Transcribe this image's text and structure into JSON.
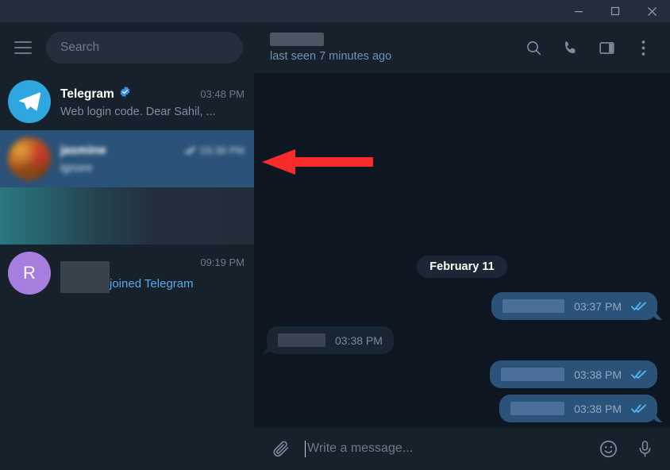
{
  "window": {
    "minimize_label": "Minimize",
    "maximize_label": "Maximize",
    "close_label": "Close"
  },
  "sidebar": {
    "menu_icon": "hamburger-icon",
    "search": {
      "placeholder": "Search",
      "value": ""
    },
    "chats": [
      {
        "name": "Telegram",
        "verified": true,
        "time": "03:48 PM",
        "preview": "Web login code. Dear Sahil, ...",
        "avatar_type": "telegram-logo",
        "avatar_label": "",
        "selected": false,
        "redacted": false
      },
      {
        "name": "jasmine",
        "verified": false,
        "time": "03:38 PM",
        "preview": "ignore",
        "avatar_type": "photo",
        "avatar_label": "",
        "selected": true,
        "redacted": true,
        "outgoing_tick": true
      },
      {
        "name": "",
        "verified": false,
        "time": "",
        "preview": "",
        "avatar_type": "none",
        "avatar_label": "",
        "selected": false,
        "redacted": true,
        "fully_obscured": true
      },
      {
        "name": "",
        "verified": false,
        "time": "09:19 PM",
        "preview": "joined Telegram",
        "avatar_type": "letter",
        "avatar_label": "R",
        "selected": false,
        "redacted": false,
        "name_redacted": true
      }
    ]
  },
  "chat_header": {
    "title": "",
    "title_redacted": true,
    "status": "last seen 7 minutes ago",
    "actions": [
      {
        "icon": "search-icon",
        "label": "Search in chat"
      },
      {
        "icon": "phone-icon",
        "label": "Call"
      },
      {
        "icon": "panel-toggle-icon",
        "label": "Toggle info panel"
      },
      {
        "icon": "more-vertical-icon",
        "label": "More options"
      }
    ]
  },
  "conversation": {
    "date_separator": "February 11",
    "messages": [
      {
        "direction": "out",
        "text": "",
        "redacted": true,
        "time": "03:37 PM",
        "status": "read",
        "tail": true,
        "redact_width": 78
      },
      {
        "direction": "in",
        "text": "",
        "redacted": true,
        "time": "03:38 PM",
        "status": "",
        "tail": true,
        "redact_width": 60
      },
      {
        "direction": "out",
        "text": "",
        "redacted": true,
        "time": "03:38 PM",
        "status": "read",
        "tail": false,
        "redact_width": 80
      },
      {
        "direction": "out",
        "text": "",
        "redacted": true,
        "time": "03:38 PM",
        "status": "read",
        "tail": true,
        "redact_width": 68
      }
    ]
  },
  "composer": {
    "attach_icon": "paperclip-icon",
    "placeholder": "Write a message...",
    "value": "",
    "emoji_icon": "smiley-icon",
    "voice_icon": "microphone-icon"
  },
  "annotation": {
    "arrow": {
      "color": "#f92c2c",
      "direction": "left",
      "target": "selected-chat-row"
    }
  },
  "colors": {
    "titlebar": "#232e3c",
    "sidebar": "#17212b",
    "chat_bg": "#0e1621",
    "selected_row": "#2b5278",
    "bubble_out": "#2b5278",
    "bubble_in": "#182533",
    "accent": "#2ea6e0",
    "tick": "#4fb3f0",
    "annotation": "#f92c2c"
  }
}
